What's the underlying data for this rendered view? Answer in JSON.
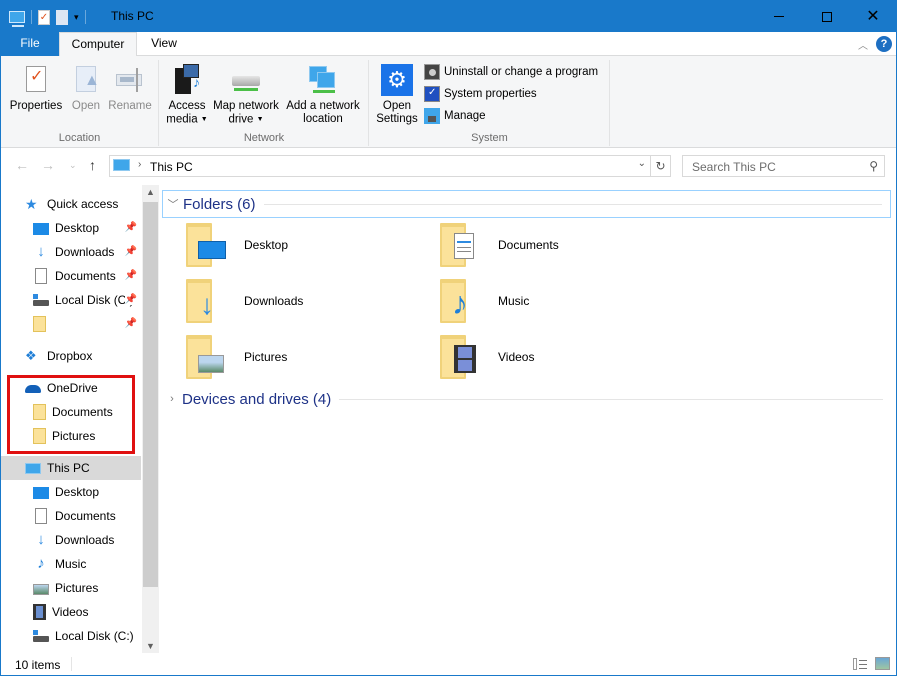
{
  "window": {
    "title": "This PC",
    "controls": {
      "minimize": "minimize",
      "maximize": "maximize",
      "close": "close"
    }
  },
  "quick_access_toolbar": {
    "icons": [
      "this-pc-icon",
      "properties-icon",
      "new-folder-icon",
      "customize-dropdown-icon"
    ]
  },
  "ribbon": {
    "tabs": [
      {
        "label": "File",
        "active": false
      },
      {
        "label": "Computer",
        "active": true
      },
      {
        "label": "View",
        "active": false
      }
    ],
    "groups": {
      "location": {
        "label": "Location",
        "buttons": [
          {
            "label": "Properties",
            "enabled": true,
            "icon": "properties-icon"
          },
          {
            "label": "Open",
            "enabled": false,
            "icon": "open-icon"
          },
          {
            "label": "Rename",
            "enabled": false,
            "icon": "rename-icon"
          }
        ]
      },
      "network": {
        "label": "Network",
        "buttons": [
          {
            "label_line1": "Access",
            "label_line2": "media",
            "dropdown": true,
            "icon": "access-media-icon"
          },
          {
            "label_line1": "Map network",
            "label_line2": "drive",
            "dropdown": true,
            "icon": "map-network-drive-icon"
          },
          {
            "label_line1": "Add a network",
            "label_line2": "location",
            "dropdown": false,
            "icon": "add-network-location-icon"
          }
        ]
      },
      "system": {
        "label": "System",
        "open_settings": {
          "label_line1": "Open",
          "label_line2": "Settings",
          "icon": "settings-gear-icon"
        },
        "small_buttons": [
          {
            "label": "Uninstall or change a program",
            "icon": "uninstall-icon"
          },
          {
            "label": "System properties",
            "icon": "system-properties-icon"
          },
          {
            "label": "Manage",
            "icon": "manage-icon"
          }
        ]
      }
    }
  },
  "address_bar": {
    "path": [
      "This PC"
    ],
    "search_placeholder": "Search This PC"
  },
  "nav_pane": {
    "items": [
      {
        "label": "Quick access",
        "level": 1,
        "icon": "star-icon"
      },
      {
        "label": "Desktop",
        "level": 2,
        "icon": "desktop-icon",
        "pinned": true
      },
      {
        "label": "Downloads",
        "level": 2,
        "icon": "downloads-icon",
        "pinned": true
      },
      {
        "label": "Documents",
        "level": 2,
        "icon": "documents-icon",
        "pinned": true
      },
      {
        "label": "Local Disk (C:)",
        "level": 2,
        "icon": "local-disk-icon",
        "pinned": true
      },
      {
        "label": "",
        "level": 2,
        "icon": "folder-icon",
        "pinned": true
      },
      {
        "label": "Dropbox",
        "level": 1,
        "icon": "dropbox-icon"
      },
      {
        "label": "OneDrive",
        "level": 1,
        "icon": "onedrive-icon"
      },
      {
        "label": "Documents",
        "level": 2,
        "icon": "folder-icon"
      },
      {
        "label": "Pictures",
        "level": 2,
        "icon": "folder-icon"
      },
      {
        "label": "This PC",
        "level": 1,
        "icon": "this-pc-icon",
        "selected": true
      },
      {
        "label": "Desktop",
        "level": 2,
        "icon": "desktop-icon"
      },
      {
        "label": "Documents",
        "level": 2,
        "icon": "documents-icon"
      },
      {
        "label": "Downloads",
        "level": 2,
        "icon": "downloads-icon"
      },
      {
        "label": "Music",
        "level": 2,
        "icon": "music-icon"
      },
      {
        "label": "Pictures",
        "level": 2,
        "icon": "pictures-icon"
      },
      {
        "label": "Videos",
        "level": 2,
        "icon": "videos-icon"
      },
      {
        "label": "Local Disk (C:)",
        "level": 2,
        "icon": "local-disk-icon"
      }
    ],
    "highlight_color": "#e01010"
  },
  "content": {
    "groups": [
      {
        "label": "Folders (6)",
        "expanded": true
      },
      {
        "label": "Devices and drives (4)",
        "expanded": false
      }
    ],
    "folders": [
      {
        "label": "Desktop",
        "icon": "desktop-folder-icon"
      },
      {
        "label": "Documents",
        "icon": "documents-folder-icon"
      },
      {
        "label": "Downloads",
        "icon": "downloads-folder-icon"
      },
      {
        "label": "Music",
        "icon": "music-folder-icon"
      },
      {
        "label": "Pictures",
        "icon": "pictures-folder-icon"
      },
      {
        "label": "Videos",
        "icon": "videos-folder-icon"
      }
    ]
  },
  "status_bar": {
    "item_count": "10 items"
  },
  "colors": {
    "accent": "#1979ca",
    "group_header_text": "#1e3287",
    "highlight_box": "#e01010"
  }
}
